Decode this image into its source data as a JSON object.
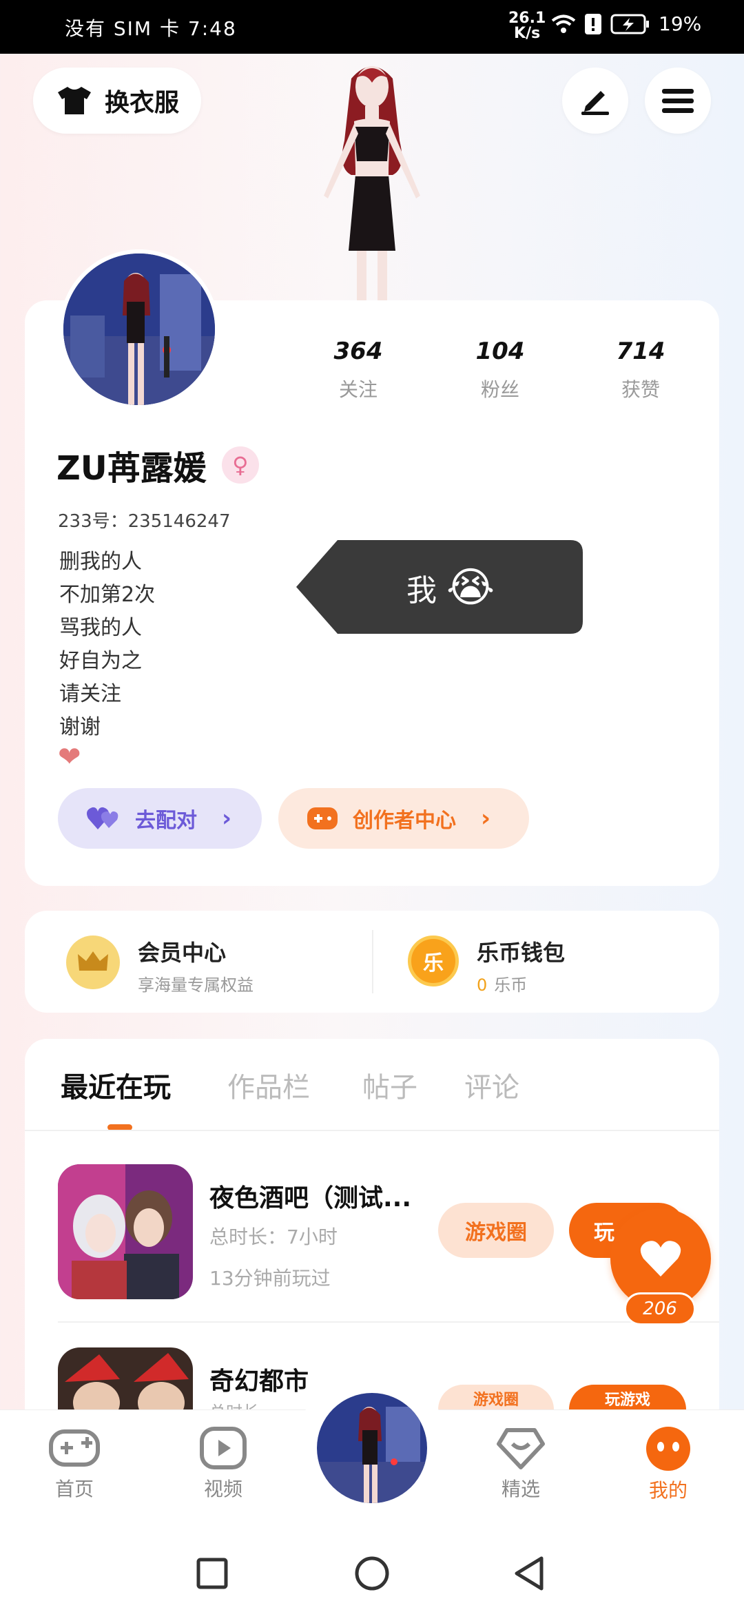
{
  "status_bar": {
    "carrier": "没有 SIM 卡",
    "time": "7:48",
    "network_speed": "26.1",
    "network_unit": "K/s",
    "battery": "19%"
  },
  "header": {
    "dress_label": "换衣服",
    "edit_icon": "pen-icon",
    "menu_icon": "menu-icon"
  },
  "profile": {
    "stats": [
      {
        "value": "364",
        "label": "关注"
      },
      {
        "value": "104",
        "label": "粉丝"
      },
      {
        "value": "714",
        "label": "获赞"
      }
    ],
    "name": "ZU苒露媛",
    "gender": "female",
    "uid": "233号：235146247",
    "bio": [
      "删我的人",
      "不加第2次",
      "骂我的人",
      "好自为之",
      "请关注",
      "谢谢"
    ],
    "bio_emoji": "❤",
    "pair_label": "去配对",
    "creator_label": "创作者中心"
  },
  "toast": {
    "text": "我",
    "emoji": "😭"
  },
  "member": {
    "title": "会员中心",
    "subtitle": "享海量专属权益"
  },
  "wallet": {
    "title": "乐币钱包",
    "balance": "0",
    "unit": "乐币",
    "coin_glyph": "乐"
  },
  "tabs": [
    "最近在玩",
    "作品栏",
    "帖子",
    "评论"
  ],
  "games": [
    {
      "title": "夜色酒吧（测试...",
      "total_time": "总时长：7小时",
      "last_played": "13分钟前玩过",
      "circle_label": "游戏圈",
      "play_label": "玩"
    },
    {
      "title": "奇幻都市",
      "total_time": "总时长",
      "circle_label": "游戏圈",
      "play_label": "玩游戏"
    }
  ],
  "likes": {
    "count": "206"
  },
  "bottom_nav": [
    {
      "label": "首页",
      "icon": "gamepad-icon"
    },
    {
      "label": "视频",
      "icon": "video-icon"
    },
    {
      "label": "精选",
      "icon": "heart-diamond-icon"
    },
    {
      "label": "我的",
      "icon": "face-icon"
    }
  ],
  "colors": {
    "accent": "#f5670f",
    "pair": "#6c5ad8",
    "creator": "#f2711f"
  }
}
